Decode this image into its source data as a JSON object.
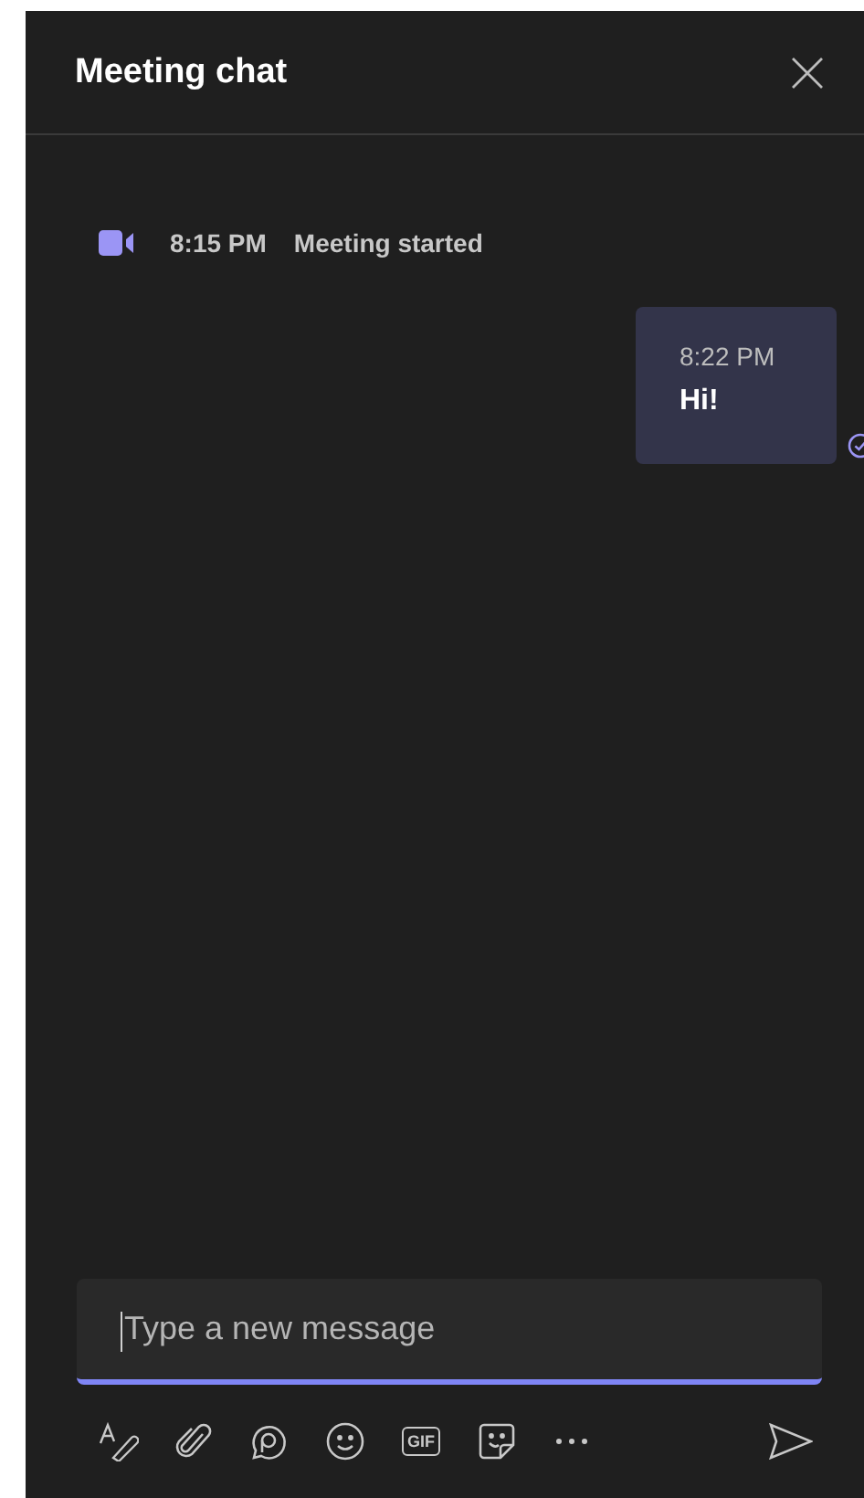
{
  "header": {
    "title": "Meeting chat"
  },
  "system_message": {
    "time": "8:15 PM",
    "text": "Meeting started"
  },
  "messages": [
    {
      "time": "8:22 PM",
      "text": "Hi!",
      "seen": true
    }
  ],
  "composer": {
    "placeholder": "Type a new message",
    "focused": true
  },
  "toolbar": [
    {
      "kind": "format"
    },
    {
      "kind": "attach"
    },
    {
      "kind": "loop"
    },
    {
      "kind": "emoji"
    },
    {
      "kind": "gif",
      "label": "GIF"
    },
    {
      "kind": "sticker"
    },
    {
      "kind": "more"
    }
  ]
}
